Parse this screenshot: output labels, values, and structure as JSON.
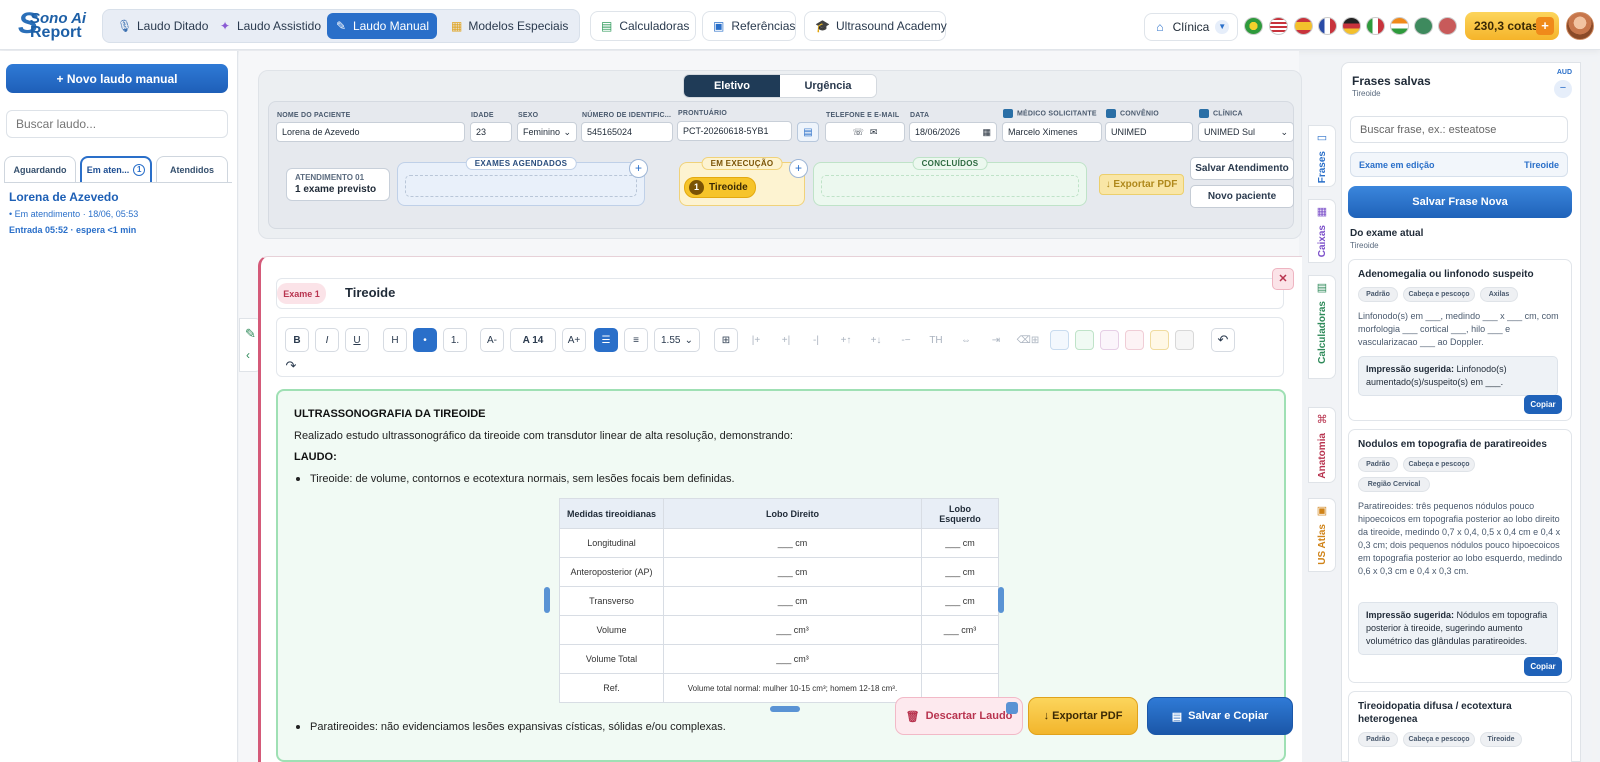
{
  "app": {
    "logo_line1": "Sono Ai",
    "logo_line2": "Report",
    "modes": [
      {
        "label": "Laudo Ditado",
        "icon": "microphone-icon"
      },
      {
        "label": "Laudo Assistido",
        "icon": "sparkles-icon"
      },
      {
        "label": "Laudo Manual",
        "icon": "pencil-icon",
        "active": true
      },
      {
        "label": "Modelos Especiais",
        "icon": "grid-icon"
      }
    ],
    "nav": {
      "calculadoras": "Calculadoras",
      "referencias": "Referências",
      "academy": "Ultrasound Academy"
    },
    "clinic_label": "Clínica",
    "cotas": "230,3 cotas",
    "cotas_plus": "+"
  },
  "sidebar": {
    "new_button": "+ Novo laudo manual",
    "search_placeholder": "Buscar laudo...",
    "tabs": [
      {
        "label": "Aguardando"
      },
      {
        "label": "Em aten...",
        "count": "1",
        "active": true
      },
      {
        "label": "Atendidos"
      }
    ],
    "patient": {
      "name": "Lorena de Azevedo",
      "status": "• Em atendimento · 18/06, 05:53",
      "entry": "Entrada 05:52 · espera <1 min"
    }
  },
  "form": {
    "segment": {
      "eletivo": "Eletivo",
      "urgencia": "Urgência"
    },
    "labels": {
      "nome": "NOME DO PACIENTE",
      "idade": "IDADE",
      "sexo": "SEXO",
      "numero": "NÚMERO DE IDENTIFIC...",
      "prontuario": "PRONTUÁRIO",
      "telefone": "TELEFONE E E-MAIL",
      "data": "DATA",
      "medico": "MÉDICO SOLICITANTE",
      "convenio": "CONVÊNIO",
      "clinica": "CLÍNICA"
    },
    "values": {
      "nome": "Lorena de Azevedo",
      "idade": "23",
      "sexo": "Feminino",
      "numero": "545165024",
      "prontuario": "PCT-20260618-5YB1",
      "data": "18/06/2026",
      "medico": "Marcelo Ximenes",
      "convenio": "UNIMED",
      "clinica": "UNIMED Sul"
    },
    "atendimento_title": "ATENDIMENTO 01",
    "atendimento_sub": "1 exame previsto",
    "zones": {
      "agendados": "EXAMES AGENDADOS",
      "execucao": "EM EXECUÇÃO",
      "concluidos": "CONCLUÍDOS"
    },
    "exec_pill_num": "1",
    "exec_pill_label": "Tireoide",
    "export_pdf": "↓ Exportar PDF",
    "salvar_atendimento": "Salvar Atendimento",
    "novo_paciente": "Novo paciente"
  },
  "exam": {
    "badge": "Exame 1",
    "title": "Tireoide",
    "close": "✕"
  },
  "toolbar": {
    "bold": "B",
    "italic": "I",
    "underline": "U",
    "heading": "H",
    "bullet": "•",
    "ordered": "1.",
    "font_down": "A-",
    "font_size": "A 14",
    "font_up": "A+",
    "line_height": "1.55",
    "undo": "↶",
    "redo": "↷",
    "table_tools": [
      "|+",
      "+|",
      "-|",
      "+↑",
      "+↓",
      "-−",
      "TH",
      "⇔",
      "⇥",
      "⌫⊞"
    ]
  },
  "document": {
    "heading": "ULTRASSONOGRAFIA DA TIREOIDE",
    "intro": "Realizado estudo ultrassonográfico da tireoide com transdutor linear de alta resolução, demonstrando:",
    "laudo_label": "LAUDO:",
    "bullet1": "Tireoide: de volume, contornos e ecotextura normais, sem lesões focais bem definidas.",
    "bullet2": "Paratireoides: não evidenciamos lesões expansivas císticas, sólidas e/ou complexas.",
    "table": {
      "headers": [
        "Medidas tireoidianas",
        "Lobo Direito",
        "Lobo Esquerdo"
      ],
      "rows": [
        [
          "Longitudinal",
          "___ cm",
          "___ cm"
        ],
        [
          "Anteroposterior (AP)",
          "___ cm",
          "___ cm"
        ],
        [
          "Transverso",
          "___ cm",
          "___ cm"
        ],
        [
          "Volume",
          "___ cm³",
          "___ cm³"
        ],
        [
          "Volume Total",
          "___ cm³",
          ""
        ],
        [
          "Ref.",
          "Volume total normal: mulher 10-15 cm³; homem 12-18 cm³.",
          ""
        ]
      ]
    }
  },
  "footer_actions": {
    "descartar": "Descartar Laudo",
    "exportar": "↓ Exportar PDF",
    "salvar": "Salvar e Copiar"
  },
  "side_tabs": [
    "Frases",
    "Caixas",
    "Calculadoras",
    "Anatomia",
    "US Atlas"
  ],
  "phrases": {
    "title": "Frases salvas",
    "subtitle": "Tireoide",
    "aud": "AUD",
    "collapse": "−",
    "search_placeholder": "Buscar frase, ex.: esteatose",
    "editing_label": "Exame em edição",
    "editing_value": "Tireoide",
    "save_new": "Salvar Frase Nova",
    "section_title": "Do exame atual",
    "section_sub": "Tireoide",
    "copy_label": "Copiar",
    "cards": [
      {
        "title": "Adenomegalia ou linfonodo suspeito",
        "tags": [
          "Padrão",
          "Cabeça e pescoço",
          "Axilas"
        ],
        "body": "Linfonodo(s) em ___, medindo ___ x ___ cm, com morfologia ___ cortical ___, hilo ___ e vascularizacao ___ ao Doppler.",
        "imp_label": "Impressão sugerida:",
        "imp": "Linfonodo(s) aumentado(s)/suspeito(s) em ___."
      },
      {
        "title": "Nodulos em topografia de paratireoides",
        "tags": [
          "Padrão",
          "Cabeça e pescoço",
          "Região Cervical"
        ],
        "body": "Paratireoides: três pequenos nódulos pouco hipoecoicos em topografia posterior ao lobo direito da tireoide, medindo 0,7 x 0,4, 0,5 x 0,4 cm e 0,4 x 0,3 cm; dois pequenos nódulos pouco hipoecoicos em topografia posterior ao lobo esquerdo, medindo 0,6 x 0,3 cm e 0,4 x 0,3 cm.",
        "imp_label": "Impressão sugerida:",
        "imp": "Nódulos em topografia posterior à tireoide, sugerindo aumento volumétrico das glândulas paratireoides."
      },
      {
        "title": "Tireoidopatia difusa / ecotextura heterogenea",
        "tags": [
          "Padrão",
          "Cabeça e pescoço",
          "Tireoide"
        ]
      }
    ]
  },
  "colors": {
    "primary": "#2a6fc9",
    "exam_accent": "#d45a79",
    "editor_border": "#9fe0b4",
    "cotas": "#f5b42a"
  }
}
